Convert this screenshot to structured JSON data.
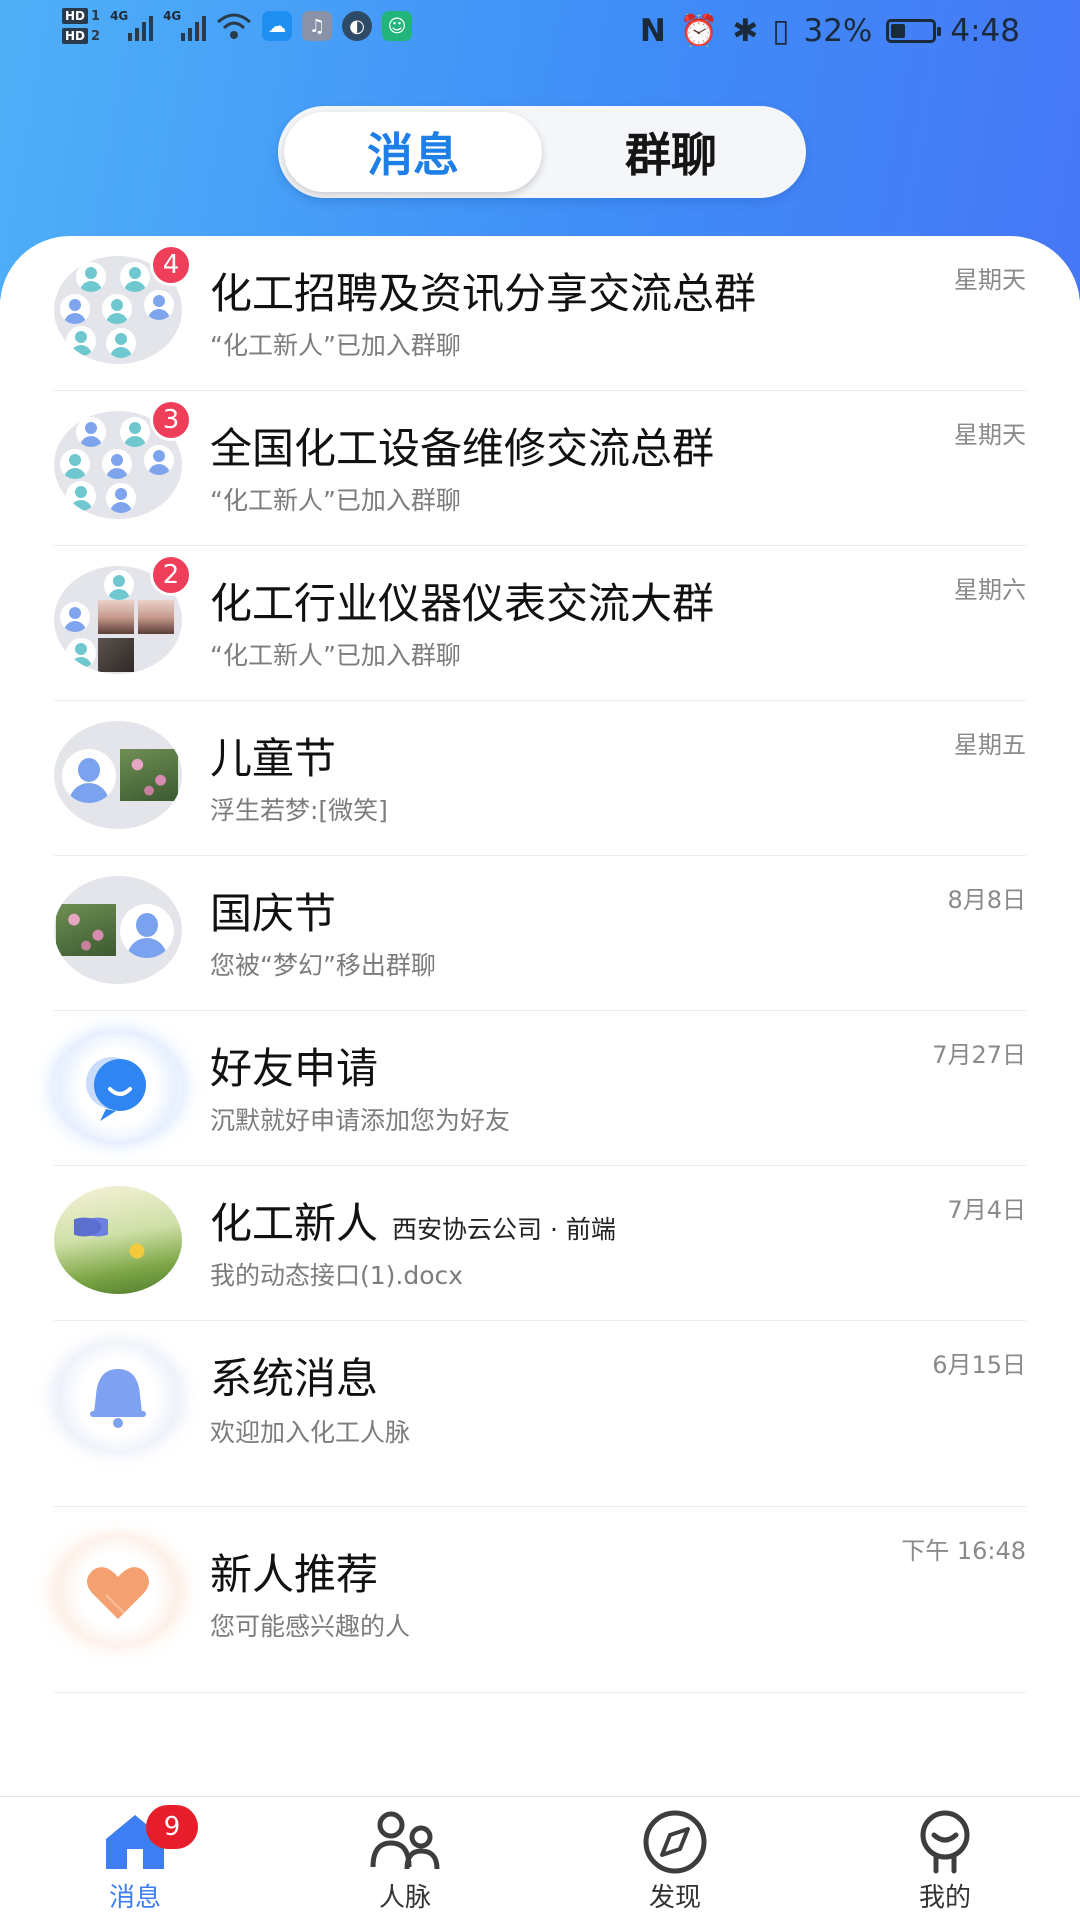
{
  "status_bar": {
    "hd1": "HD",
    "hd1_num": "1",
    "hd2": "HD",
    "hd2_num": "2",
    "net1": "4G",
    "net2": "4G",
    "battery_text": "32%",
    "battery_level": 0.32,
    "time": "4:48"
  },
  "segment": {
    "tabs": [
      {
        "label": "消息",
        "active": true
      },
      {
        "label": "群聊",
        "active": false
      }
    ]
  },
  "conversations": [
    {
      "title": "化工招聘及资讯分享交流总群",
      "subtitle": "“化工新人”已加入群聊",
      "time": "星期天",
      "badge": "4",
      "avatar": "group-avatars"
    },
    {
      "title": "全国化工设备维修交流总群",
      "subtitle": "“化工新人”已加入群聊",
      "time": "星期天",
      "badge": "3",
      "avatar": "group-avatars"
    },
    {
      "title": "化工行业仪器仪表交流大群",
      "subtitle": "“化工新人”已加入群聊",
      "time": "星期六",
      "badge": "2",
      "avatar": "group-photos"
    },
    {
      "title": "儿童节",
      "subtitle": "浮生若梦:[微笑]",
      "time": "星期五",
      "badge": "",
      "avatar": "person-and-flowers"
    },
    {
      "title": "国庆节",
      "subtitle": "您被“梦幻”移出群聊",
      "time": "8月8日",
      "badge": "",
      "avatar": "flowers-and-person"
    },
    {
      "title": "好友申请",
      "subtitle": "沉默就好申请添加您为好友",
      "time": "7月27日",
      "badge": "",
      "avatar": "chat-bubble-icon"
    },
    {
      "title": "化工新人",
      "title_extra": "西安协云公司 · 前端",
      "subtitle": "我的动态接口(1).docx",
      "time": "7月4日",
      "badge": "",
      "avatar": "butterfly-photo"
    },
    {
      "title": "系统消息",
      "subtitle": "欢迎加入化工人脉",
      "time": "6月15日",
      "badge": "",
      "avatar": "bell-icon"
    },
    {
      "title": "新人推荐",
      "subtitle": "您可能感兴趣的人",
      "time": "下午 16:48",
      "badge": "",
      "avatar": "heart-icon"
    }
  ],
  "tabbar": {
    "items": [
      {
        "label": "消息",
        "icon": "home-icon",
        "active": true,
        "badge": "9"
      },
      {
        "label": "人脉",
        "icon": "contacts-icon",
        "active": false
      },
      {
        "label": "发现",
        "icon": "compass-icon",
        "active": false
      },
      {
        "label": "我的",
        "icon": "profile-icon",
        "active": false
      }
    ]
  },
  "colors": {
    "accent": "#3e7ef3",
    "header_gradient_start": "#4fb0f7",
    "header_gradient_end": "#4677f6",
    "badge_red": "#ef3e5a",
    "tab_badge_red": "#e81d2b"
  }
}
